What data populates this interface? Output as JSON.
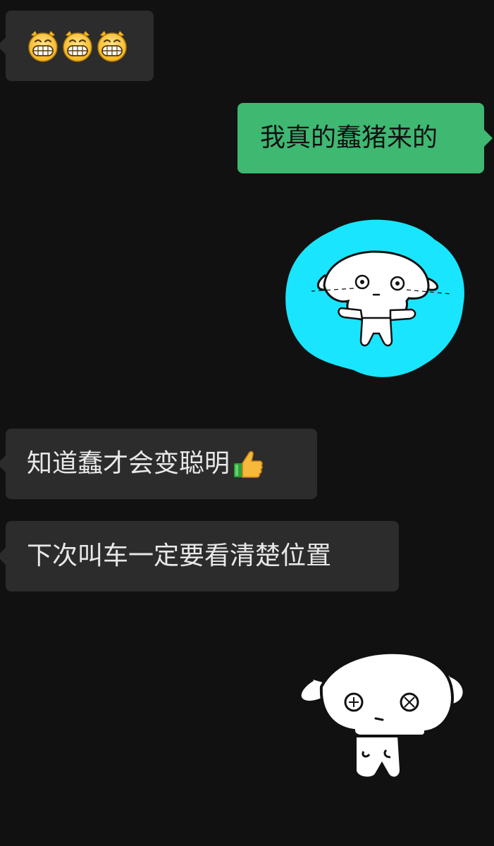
{
  "chat": {
    "messages": [
      {
        "side": "left",
        "type": "emoji",
        "emojis": [
          "grinning-face-icon",
          "grinning-face-icon",
          "grinning-face-icon"
        ]
      },
      {
        "side": "right",
        "type": "text",
        "text": "我真的蠢猪来的"
      },
      {
        "side": "right",
        "type": "sticker",
        "sticker": "crying-bunny-sticker-cyan"
      },
      {
        "side": "left",
        "type": "text",
        "text": "知道蠢才会变聪明",
        "trailing_emoji": "thumbs-up-icon"
      },
      {
        "side": "left",
        "type": "text",
        "text": "下次叫车一定要看清楚位置"
      },
      {
        "side": "right",
        "type": "sticker",
        "sticker": "sad-bunny-sticker"
      }
    ]
  },
  "colors": {
    "background": "#111111",
    "incoming_bubble": "#2c2c2c",
    "outgoing_bubble": "#3fb872",
    "sticker_glow": "#19e5ff"
  }
}
